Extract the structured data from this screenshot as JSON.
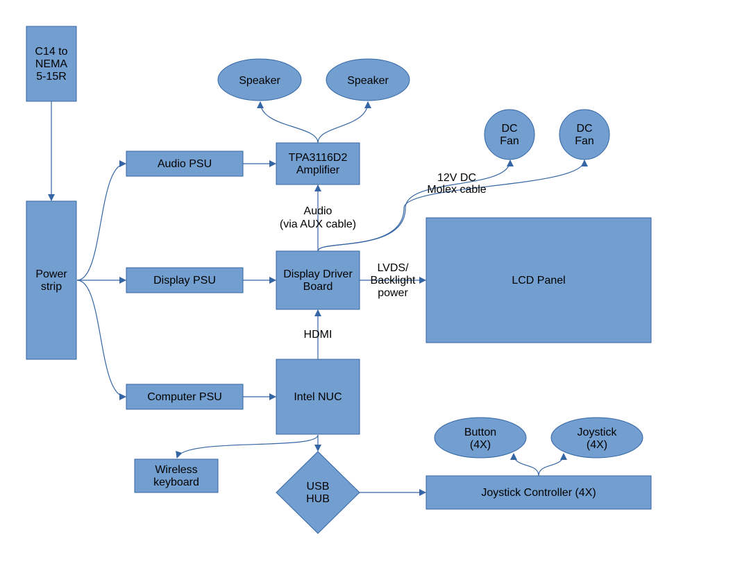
{
  "diagram": {
    "colors": {
      "node_fill": "#729fcf",
      "node_stroke": "#3465a4",
      "edge": "#3465a4",
      "text": "#000000"
    },
    "nodes": {
      "c14": {
        "shape": "rect",
        "lines": [
          "C14 to",
          "NEMA",
          "5-15R"
        ]
      },
      "power_strip": {
        "shape": "rect",
        "lines": [
          "Power",
          "strip"
        ]
      },
      "audio_psu": {
        "shape": "rect",
        "lines": [
          "Audio PSU"
        ]
      },
      "display_psu": {
        "shape": "rect",
        "lines": [
          "Display PSU"
        ]
      },
      "computer_psu": {
        "shape": "rect",
        "lines": [
          "Computer PSU"
        ]
      },
      "amplifier": {
        "shape": "rect",
        "lines": [
          "TPA3116D2",
          "Amplifier"
        ]
      },
      "speaker_left": {
        "shape": "ellipse",
        "lines": [
          "Speaker"
        ]
      },
      "speaker_right": {
        "shape": "ellipse",
        "lines": [
          "Speaker"
        ]
      },
      "display_driver": {
        "shape": "rect",
        "lines": [
          "Display Driver",
          "Board"
        ]
      },
      "lcd_panel": {
        "shape": "rect",
        "lines": [
          "LCD Panel"
        ]
      },
      "fan_left": {
        "shape": "circle",
        "lines": [
          "DC",
          "Fan"
        ]
      },
      "fan_right": {
        "shape": "circle",
        "lines": [
          "DC",
          "Fan"
        ]
      },
      "nuc": {
        "shape": "rect",
        "lines": [
          "Intel NUC"
        ]
      },
      "keyboard": {
        "shape": "rect",
        "lines": [
          "Wireless",
          "keyboard"
        ]
      },
      "usb_hub": {
        "shape": "diamond",
        "lines": [
          "USB",
          "HUB"
        ]
      },
      "joystick_controller": {
        "shape": "rect",
        "lines": [
          "Joystick Controller (4X)"
        ]
      },
      "button": {
        "shape": "ellipse",
        "lines": [
          "Button",
          "(4X)"
        ]
      },
      "joystick": {
        "shape": "ellipse",
        "lines": [
          "Joystick",
          "(4X)"
        ]
      }
    },
    "edges": [
      {
        "from": "c14",
        "to": "power_strip",
        "label": []
      },
      {
        "from": "power_strip",
        "to": "audio_psu",
        "label": []
      },
      {
        "from": "power_strip",
        "to": "display_psu",
        "label": []
      },
      {
        "from": "power_strip",
        "to": "computer_psu",
        "label": []
      },
      {
        "from": "audio_psu",
        "to": "amplifier",
        "label": []
      },
      {
        "from": "display_psu",
        "to": "display_driver",
        "label": []
      },
      {
        "from": "computer_psu",
        "to": "nuc",
        "label": []
      },
      {
        "from": "amplifier",
        "to": "speaker_left",
        "label": []
      },
      {
        "from": "amplifier",
        "to": "speaker_right",
        "label": []
      },
      {
        "from": "display_driver",
        "to": "amplifier",
        "label": [
          "Audio",
          "(via AUX cable)"
        ]
      },
      {
        "from": "display_driver",
        "to": "lcd_panel",
        "label": [
          "LVDS/",
          "Backlight",
          "power"
        ]
      },
      {
        "from": "display_driver",
        "to": "fan_left",
        "label": [
          "12V DC",
          "Molex cable"
        ]
      },
      {
        "from": "display_driver",
        "to": "fan_right",
        "label": []
      },
      {
        "from": "nuc",
        "to": "display_driver",
        "label": [
          "HDMI"
        ]
      },
      {
        "from": "nuc",
        "to": "keyboard",
        "label": []
      },
      {
        "from": "nuc",
        "to": "usb_hub",
        "label": []
      },
      {
        "from": "usb_hub",
        "to": "joystick_controller",
        "label": []
      },
      {
        "from": "joystick_controller",
        "to": "button",
        "label": []
      },
      {
        "from": "joystick_controller",
        "to": "joystick",
        "label": []
      }
    ]
  }
}
